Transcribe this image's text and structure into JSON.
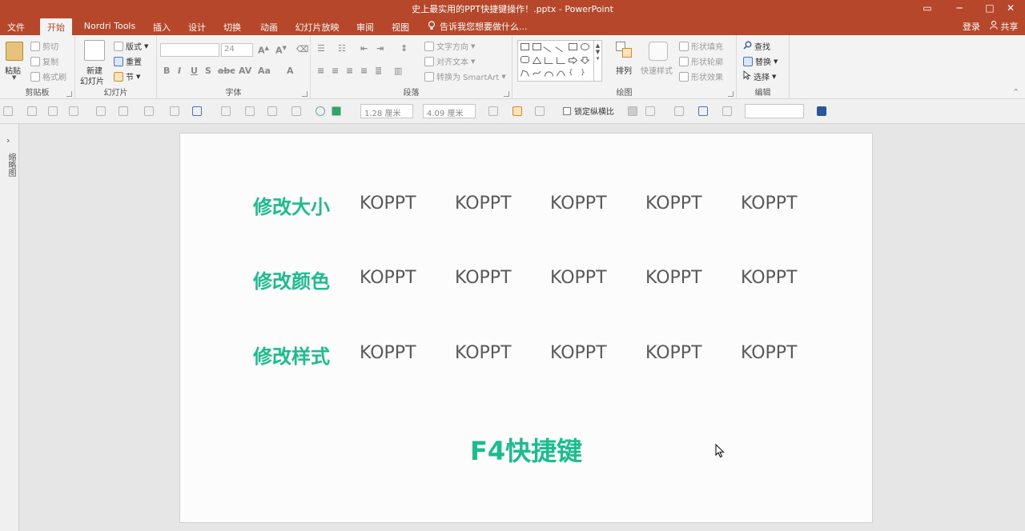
{
  "window": {
    "title": "史上最实用的PPT快捷键操作！.pptx - PowerPoint",
    "min": "─",
    "max": "□",
    "close": "✕",
    "ribbon_opts": "▭"
  },
  "tabs": [
    {
      "label": "文件"
    },
    {
      "label": "开始"
    },
    {
      "label": "Nordri Tools"
    },
    {
      "label": "插入"
    },
    {
      "label": "设计"
    },
    {
      "label": "切换"
    },
    {
      "label": "动画"
    },
    {
      "label": "幻灯片放映"
    },
    {
      "label": "审阅"
    },
    {
      "label": "视图"
    }
  ],
  "tell_me": "告诉我您想要做什么...",
  "login": "登录",
  "share": "共享",
  "ribbon": {
    "clipboard": {
      "label": "剪贴板",
      "paste": "粘贴",
      "cut": "剪切",
      "copy": "复制",
      "format_painter": "格式刷"
    },
    "slides": {
      "label": "幻灯片",
      "new_slide_1": "新建",
      "new_slide_2": "幻灯片",
      "layout": "版式",
      "reset": "重置",
      "section": "节"
    },
    "font": {
      "label": "字体",
      "size": "24"
    },
    "paragraph": {
      "label": "段落",
      "text_direction": "文字方向",
      "align_text": "对齐文本",
      "smartart": "转换为 SmartArt"
    },
    "drawing": {
      "label": "绘图",
      "arrange": "排列",
      "quick_styles": "快速样式",
      "shape_fill": "形状填充",
      "shape_outline": "形状轮廓",
      "shape_effects": "形状效果"
    },
    "editing": {
      "label": "编辑",
      "find": "查找",
      "replace": "替换",
      "select": "选择"
    }
  },
  "format_bar": {
    "height": "1.28 厘米",
    "width": "4.09 厘米",
    "lock_ratio": "锁定纵横比"
  },
  "left_pane": {
    "label": "缩略图"
  },
  "slide": {
    "rows": [
      {
        "label": "修改大小",
        "items": [
          "KOPPT",
          "KOPPT",
          "KOPPT",
          "KOPPT",
          "KOPPT"
        ]
      },
      {
        "label": "修改颜色",
        "items": [
          "KOPPT",
          "KOPPT",
          "KOPPT",
          "KOPPT",
          "KOPPT"
        ]
      },
      {
        "label": "修改样式",
        "items": [
          "KOPPT",
          "KOPPT",
          "KOPPT",
          "KOPPT",
          "KOPPT"
        ]
      }
    ],
    "title": "F4快捷键"
  },
  "colors": {
    "brand": "#b7472a",
    "accent_green": "#1bbc8e",
    "text_gray": "#595959"
  }
}
